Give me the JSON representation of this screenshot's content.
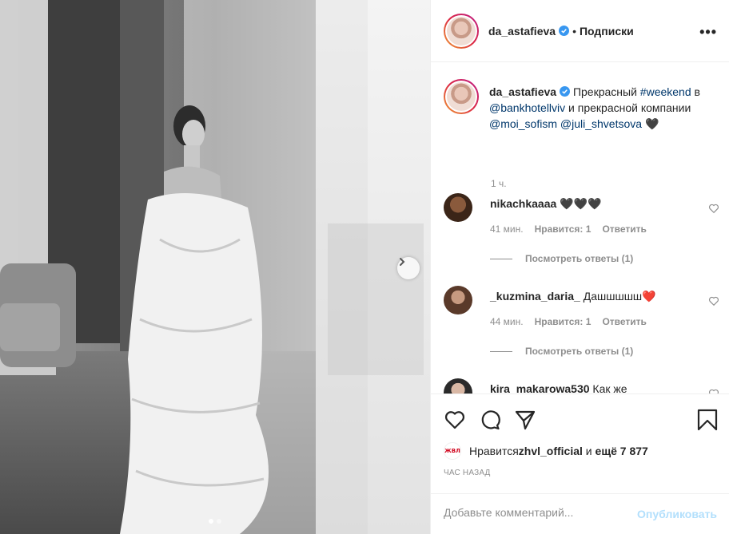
{
  "post": {
    "username": "da_astafieva",
    "separator": "•",
    "follow_label": "Подписки",
    "more_label": "•••"
  },
  "caption": {
    "username": "da_astafieva",
    "text_1": " Прекрасный ",
    "hashtag": "#weekend",
    "text_2": " в ",
    "mention_1": "@bankhotellviv",
    "text_3": " и прекрасной компании ",
    "mention_2": "@moi_sofism",
    "text_4": " ",
    "mention_3": "@juli_shvetsova",
    "text_5": " 🖤",
    "time": "1 ч."
  },
  "comments": [
    {
      "username": "nikachkaaaa",
      "text": " 🖤🖤🖤",
      "time": "41 мин.",
      "likes": "Нравится: 1",
      "reply_label": "Ответить",
      "view_replies": "Посмотреть ответы (1)"
    },
    {
      "username": "_kuzmina_daria_",
      "text": " Дашшшшш❤️",
      "time": "44 мин.",
      "likes": "Нравится: 1",
      "reply_label": "Ответить",
      "view_replies": "Посмотреть ответы (1)"
    },
    {
      "username": "kira_makarowa530",
      "text": " Как же"
    }
  ],
  "likes": {
    "avatar_label": "ЖВЛ",
    "prefix": "Нравится ",
    "user": "zhvl_official",
    "middle": " и ",
    "count": "ещё 7 877"
  },
  "posted_ago": "ЧАС НАЗАД",
  "add_comment": {
    "placeholder": "Добавьте комментарий...",
    "publish_label": "Опубликовать"
  },
  "carousel": {
    "dot_count": 2,
    "active_index": 0
  }
}
